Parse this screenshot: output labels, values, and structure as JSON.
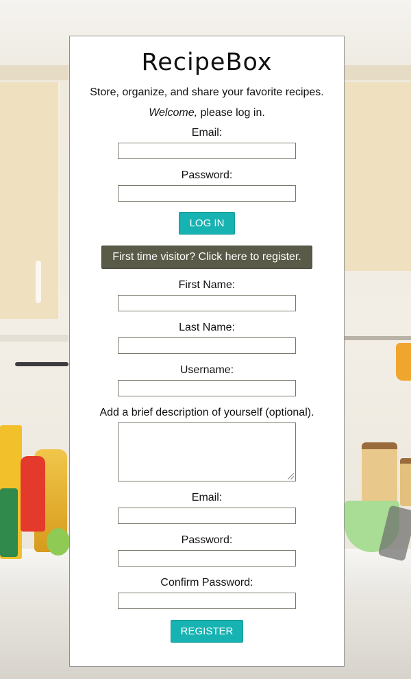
{
  "app": {
    "logo": "RecipeBox",
    "tagline": "Store, organize, and share your favorite recipes.",
    "welcome_em": "Welcome,",
    "welcome_rest": " please log in."
  },
  "login": {
    "email_label": "Email:",
    "email_value": "",
    "password_label": "Password:",
    "password_value": "",
    "login_button": "LOG IN"
  },
  "register_toggle": "First time visitor? Click here to register.",
  "register": {
    "first_name_label": "First Name:",
    "last_name_label": "Last Name:",
    "username_label": "Username:",
    "description_label": "Add a brief description of yourself (optional).",
    "email_label": "Email:",
    "password_label": "Password:",
    "confirm_password_label": "Confirm Password:",
    "register_button": "REGISTER"
  },
  "colors": {
    "accent": "#17b3b2",
    "secondary_button": "#5a5a48",
    "card_border": "#8f8f8f"
  }
}
